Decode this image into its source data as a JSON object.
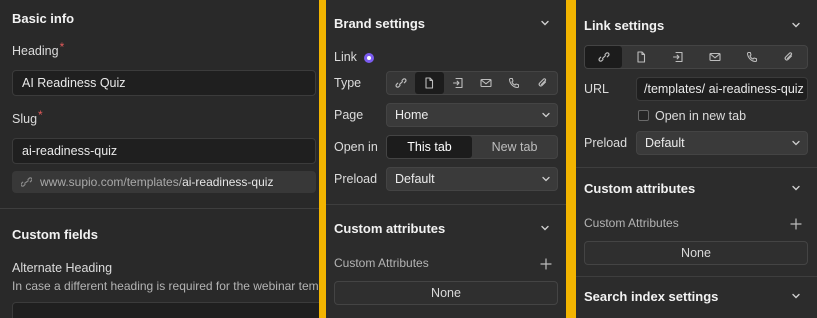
{
  "basic_info": {
    "title": "Basic info",
    "heading_label": "Heading",
    "required_mark": "*",
    "heading_value": "AI Readiness Quiz",
    "slug_label": "Slug",
    "slug_value": "ai-readiness-quiz",
    "url_prefix": "www.supio.com/templates/",
    "url_slug": "ai-readiness-quiz"
  },
  "custom_fields": {
    "title": "Custom fields",
    "alt_heading_label": "Alternate Heading",
    "alt_heading_help": "In case a different heading is required for the webinar tem"
  },
  "brand_settings": {
    "title": "Brand settings",
    "link_label": "Link",
    "type_label": "Type",
    "type_icons": [
      "link-icon",
      "page-icon",
      "section-icon",
      "email-icon",
      "phone-icon",
      "attachment-icon"
    ],
    "active_type": "page-icon",
    "page_label": "Page",
    "page_value": "Home",
    "open_in_label": "Open in",
    "open_in_options": [
      "This tab",
      "New tab"
    ],
    "open_in_selected": "This tab",
    "preload_label": "Preload",
    "preload_value": "Default"
  },
  "custom_attributes_mid": {
    "title": "Custom attributes",
    "sub_label": "Custom Attributes",
    "none": "None"
  },
  "link_settings": {
    "title": "Link settings",
    "type_icons": [
      "link-icon",
      "page-icon",
      "section-icon",
      "email-icon",
      "phone-icon",
      "attachment-icon"
    ],
    "url_label": "URL",
    "url_value": "/templates/ ai-readiness-quiz",
    "open_new_tab_label": "Open in new tab",
    "open_new_tab_checked": false,
    "preload_label": "Preload",
    "preload_value": "Default"
  },
  "custom_attributes_right": {
    "title": "Custom attributes",
    "sub_label": "Custom Attributes",
    "none": "None"
  },
  "search_index": {
    "title": "Search index settings"
  },
  "colors": {
    "panel_bg": "#292929",
    "input_bg": "#1f1f1f",
    "required": "#e25a5a",
    "radio_accent": "#7b5cf0",
    "gap_bg": "#f2b400"
  }
}
